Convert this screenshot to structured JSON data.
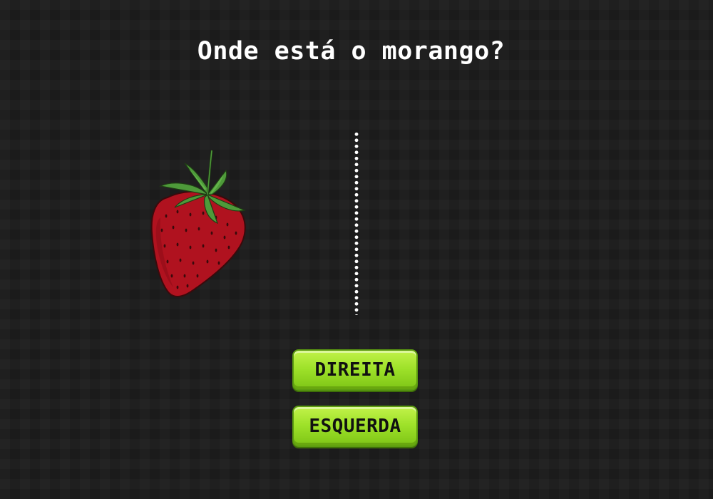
{
  "game": {
    "question": "Onde está o morango?"
  },
  "buttons": {
    "right_label": "DIREITA",
    "left_label": "ESQUERDA"
  },
  "strawberry": {
    "icon": "strawberry-icon",
    "side": "left"
  },
  "colors": {
    "background": "#1b1b1b",
    "button": "#9fe22a",
    "strawberry": "#b0121f",
    "leaves": "#4e9a3a"
  }
}
